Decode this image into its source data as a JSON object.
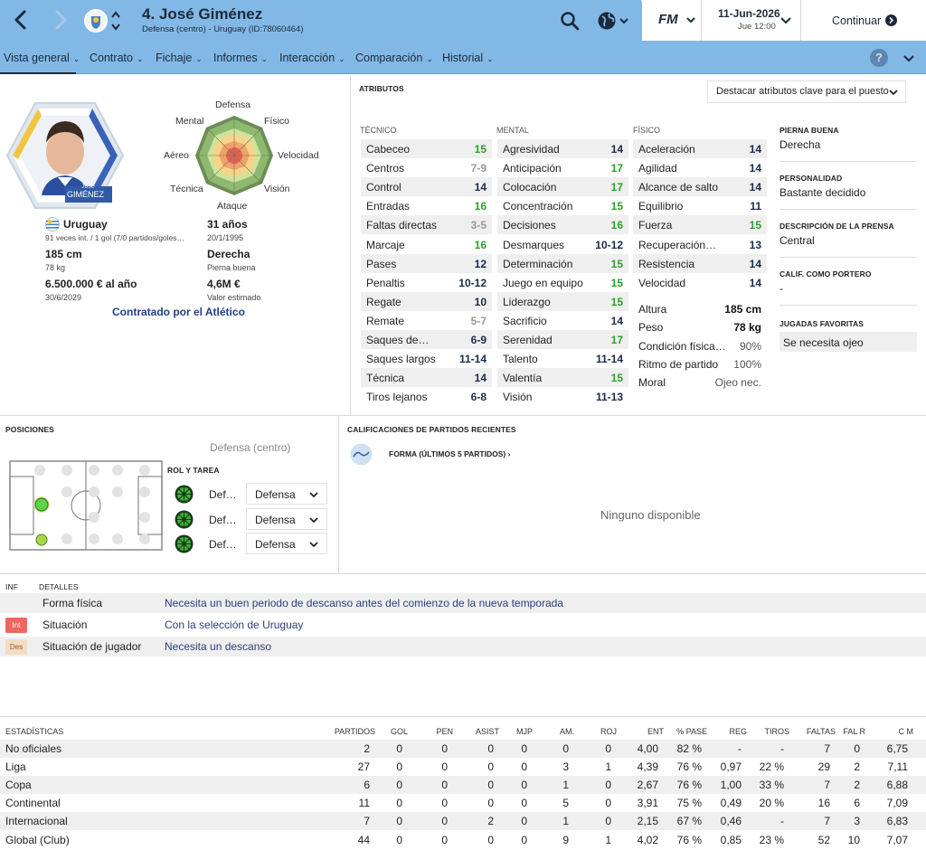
{
  "header": {
    "player_title": "4. José Giménez",
    "player_subtitle": "Defensa (centro) - Uruguay (ID:78060464)",
    "fm_label": "FM",
    "date": "11-Jun-2026",
    "day_time": "Jue 12:00",
    "continue_label": "Continuar"
  },
  "nav": {
    "tabs": [
      "Vista general",
      "Contrato",
      "Fichaje",
      "Informes",
      "Interacción",
      "Comparación",
      "Historial"
    ],
    "help_label": "?"
  },
  "profile": {
    "card_first_name": "José",
    "card_last_name": "GIMÉNEZ",
    "nationality": "Uruguay",
    "caps": "91 veces int. / 1 gol (7/0 partidos/goles…",
    "age": "31 años",
    "dob": "20/1/1995",
    "height": "185 cm",
    "weight": "78 kg",
    "foot": "Derecha",
    "foot_label": "Pierna buena",
    "wage": "6.500.000 € al año",
    "contract_end": "30/6/2029",
    "value": "4,6M €",
    "value_label": "Valor estimado",
    "contracted_by": "Contratado por el Atlético"
  },
  "radar": {
    "labels": [
      "Defensa",
      "Físico",
      "Velocidad",
      "Visión",
      "Ataque",
      "Técnica",
      "Aéreo",
      "Mental"
    ]
  },
  "attributes": {
    "section_title": "ATRIBUTOS",
    "highlight_dropdown": "Destacar atributos clave para el puesto",
    "tecnico_header": "TÉCNICO",
    "mental_header": "MENTAL",
    "fisico_header": "FÍSICO",
    "tecnico": [
      {
        "name": "Cabeceo",
        "value": "15",
        "color": "g"
      },
      {
        "name": "Centros",
        "value": "7-9",
        "color": "gy"
      },
      {
        "name": "Control",
        "value": "14",
        "color": "n"
      },
      {
        "name": "Entradas",
        "value": "16",
        "color": "g"
      },
      {
        "name": "Faltas directas",
        "value": "3-5",
        "color": "gy"
      },
      {
        "name": "Marcaje",
        "value": "16",
        "color": "g"
      },
      {
        "name": "Pases",
        "value": "12",
        "color": "n"
      },
      {
        "name": "Penaltis",
        "value": "10-12",
        "color": "n"
      },
      {
        "name": "Regate",
        "value": "10",
        "color": "n"
      },
      {
        "name": "Remate",
        "value": "5-7",
        "color": "gy"
      },
      {
        "name": "Saques de…",
        "value": "6-9",
        "color": "n"
      },
      {
        "name": "Saques largos",
        "value": "11-14",
        "color": "n"
      },
      {
        "name": "Técnica",
        "value": "14",
        "color": "n"
      },
      {
        "name": "Tiros lejanos",
        "value": "6-8",
        "color": "n"
      }
    ],
    "mental": [
      {
        "name": "Agresividad",
        "value": "14",
        "color": "n"
      },
      {
        "name": "Anticipación",
        "value": "17",
        "color": "g"
      },
      {
        "name": "Colocación",
        "value": "17",
        "color": "g"
      },
      {
        "name": "Concentración",
        "value": "15",
        "color": "g"
      },
      {
        "name": "Decisiones",
        "value": "16",
        "color": "g"
      },
      {
        "name": "Desmarques",
        "value": "10-12",
        "color": "n"
      },
      {
        "name": "Determinación",
        "value": "15",
        "color": "g"
      },
      {
        "name": "Juego en equipo",
        "value": "15",
        "color": "g"
      },
      {
        "name": "Liderazgo",
        "value": "15",
        "color": "g"
      },
      {
        "name": "Sacrificio",
        "value": "14",
        "color": "n"
      },
      {
        "name": "Serenidad",
        "value": "17",
        "color": "g"
      },
      {
        "name": "Talento",
        "value": "11-14",
        "color": "n"
      },
      {
        "name": "Valentía",
        "value": "15",
        "color": "g"
      },
      {
        "name": "Visión",
        "value": "11-13",
        "color": "n"
      }
    ],
    "fisico": [
      {
        "name": "Aceleración",
        "value": "14",
        "color": "n"
      },
      {
        "name": "Agilidad",
        "value": "14",
        "color": "n"
      },
      {
        "name": "Alcance de salto",
        "value": "14",
        "color": "n"
      },
      {
        "name": "Equilibrio",
        "value": "11",
        "color": "n"
      },
      {
        "name": "Fuerza",
        "value": "15",
        "color": "g"
      },
      {
        "name": "Recuperación…",
        "value": "13",
        "color": "n"
      },
      {
        "name": "Resistencia",
        "value": "14",
        "color": "n"
      },
      {
        "name": "Velocidad",
        "value": "14",
        "color": "n"
      }
    ],
    "extra": [
      {
        "name": "Altura",
        "value": "185 cm"
      },
      {
        "name": "Peso",
        "value": "78 kg"
      },
      {
        "name": "Condición física…",
        "value": "90%"
      },
      {
        "name": "Ritmo de partido",
        "value": "100%"
      },
      {
        "name": "Moral",
        "value": "Ojeo nec."
      }
    ]
  },
  "side_info": {
    "foot_title": "PIERNA BUENA",
    "foot_value": "Derecha",
    "personality_title": "PERSONALIDAD",
    "personality_value": "Bastante decidido",
    "press_title": "DESCRIPCIÓN DE LA PRENSA",
    "press_value": "Central",
    "gk_title": "CALIF. COMO PORTERO",
    "gk_value": "-",
    "moves_title": "JUGADAS FAVORITAS",
    "moves_value": "Se necesita ojeo"
  },
  "positions": {
    "title": "POSICIONES",
    "position_label": "Defensa (centro)",
    "role_title": "ROL Y TAREA",
    "roles": [
      {
        "role": "Def…",
        "duty": "Defensa"
      },
      {
        "role": "Def…",
        "duty": "Defensa"
      },
      {
        "role": "Def…",
        "duty": "Defensa"
      }
    ]
  },
  "recent": {
    "title": "CALIFICACIONES DE PARTIDOS RECIENTES",
    "form_label": "FORMA (ÚLTIMOS 5 PARTIDOS)",
    "empty_label": "Ninguno disponible"
  },
  "info": {
    "col_inf": "INF",
    "col_details": "DETALLES",
    "rows": [
      {
        "badge": "",
        "label": "Forma física",
        "detail": "Necesita un buen periodo de descanso antes del comienzo de la nueva temporada"
      },
      {
        "badge": "Int",
        "label": "Situación",
        "detail": "Con la selección de Uruguay"
      },
      {
        "badge": "Des",
        "label": "Situación de jugador",
        "detail": "Necesita un descanso"
      }
    ]
  },
  "stats": {
    "headers": [
      "ESTADÍSTICAS",
      "PARTIDOS",
      "GOL",
      "PEN",
      "ASIST",
      "MJP",
      "AM.",
      "ROJ",
      "ENT",
      "% PASE",
      "REG",
      "TIROS",
      "FALTAS",
      "FAL R",
      "C M"
    ],
    "rows": [
      [
        "No oficiales",
        "2",
        "0",
        "0",
        "0",
        "0",
        "0",
        "0",
        "4,00",
        "82 %",
        "-",
        "-",
        "7",
        "0",
        "6,75"
      ],
      [
        "Liga",
        "27",
        "0",
        "0",
        "0",
        "0",
        "3",
        "1",
        "4,39",
        "76 %",
        "0,97",
        "22 %",
        "29",
        "2",
        "7,11"
      ],
      [
        "Copa",
        "6",
        "0",
        "0",
        "0",
        "0",
        "1",
        "0",
        "2,67",
        "76 %",
        "1,00",
        "33 %",
        "7",
        "2",
        "6,88"
      ],
      [
        "Continental",
        "11",
        "0",
        "0",
        "0",
        "0",
        "5",
        "0",
        "3,91",
        "75 %",
        "0,49",
        "20 %",
        "16",
        "6",
        "7,09"
      ],
      [
        "Internacional",
        "7",
        "0",
        "0",
        "2",
        "0",
        "1",
        "0",
        "2,15",
        "67 %",
        "0,46",
        "-",
        "7",
        "3",
        "6,83"
      ],
      [
        "Global (Club)",
        "44",
        "0",
        "0",
        "0",
        "0",
        "9",
        "1",
        "4,02",
        "76 %",
        "0,85",
        "23 %",
        "52",
        "10",
        "7,07"
      ]
    ]
  }
}
